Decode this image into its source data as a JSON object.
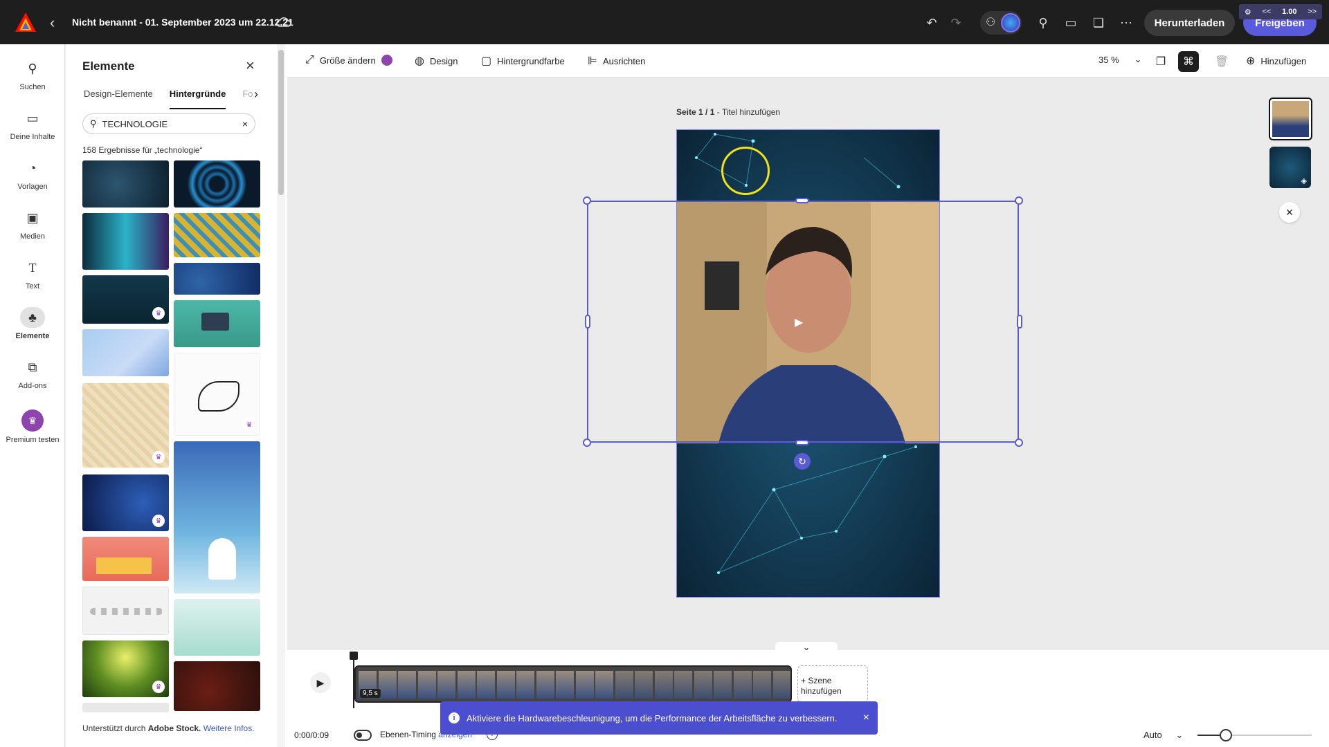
{
  "topbar": {
    "doc_title": "Nicht benannt - 01. September 2023 um 22.12.21",
    "download_label": "Herunterladen",
    "share_label": "Freigeben",
    "zoom_overlay_value": "1.00",
    "zoom_overlay_prev": "<<",
    "zoom_overlay_next": ">>"
  },
  "rail": {
    "items": [
      {
        "label": "Suchen",
        "icon": "search-icon"
      },
      {
        "label": "Deine Inhalte",
        "icon": "folder-icon"
      },
      {
        "label": "Vorlagen",
        "icon": "templates-icon"
      },
      {
        "label": "Medien",
        "icon": "media-icon"
      },
      {
        "label": "Text",
        "icon": "text-icon"
      },
      {
        "label": "Elemente",
        "icon": "shapes-icon"
      },
      {
        "label": "Add-ons",
        "icon": "addons-icon"
      },
      {
        "label": "Premium testen",
        "icon": "crown-icon"
      }
    ]
  },
  "panel": {
    "title": "Elemente",
    "tabs": [
      "Design-Elemente",
      "Hintergründe",
      "Fo"
    ],
    "search_value": "TECHNOLOGIE",
    "results_text": "158 Ergebnisse für „technologie“",
    "footer_prefix": "Unterstützt durch ",
    "footer_brand": "Adobe Stock.",
    "footer_link": "Weitere Infos."
  },
  "toolbar": {
    "resize_label": "Größe ändern",
    "design_label": "Design",
    "bgcolor_label": "Hintergrundfarbe",
    "align_label": "Ausrichten",
    "zoom_value": "35 %",
    "add_label": "Hinzufügen"
  },
  "canvas": {
    "page_label_bold": "Seite 1 / 1",
    "page_label_rest": " - Titel hinzufügen"
  },
  "timeline": {
    "clip_duration": "9,5 s",
    "add_scene_line1": "+ Szene",
    "add_scene_line2": "hinzufügen",
    "time": "0:00/0:09",
    "layer_timing_label": "Ebenen-Timing ",
    "layer_timing_link": "anzeigen",
    "auto_label": "Auto",
    "zoom_level": 0.25
  },
  "toast": {
    "message": "Aktiviere die Hardwarebeschleunigung, um die Performance der Arbeitsfläche zu verbessern."
  },
  "colors": {
    "accent": "#5a5bdb",
    "selection": "#5b5bd6",
    "topbar": "#1e1e1e",
    "premium": "#8e44ad"
  }
}
